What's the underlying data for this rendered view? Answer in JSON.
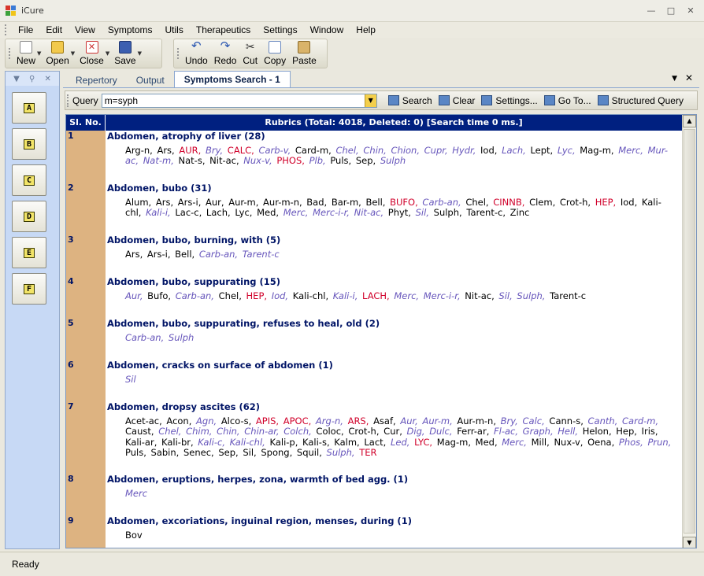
{
  "app": {
    "title": "iCure"
  },
  "menu": [
    "File",
    "Edit",
    "View",
    "Symptoms",
    "Utils",
    "Therapeutics",
    "Settings",
    "Window",
    "Help"
  ],
  "toolbar1": [
    {
      "label": "New",
      "icon": "new-document-icon",
      "dropdown": true
    },
    {
      "label": "Open",
      "icon": "open-folder-icon",
      "dropdown": true
    },
    {
      "label": "Close",
      "icon": "close-document-icon",
      "dropdown": true
    },
    {
      "label": "Save",
      "icon": "save-disk-icon",
      "dropdown": true
    }
  ],
  "toolbar2": [
    {
      "label": "Undo",
      "icon": "undo-icon"
    },
    {
      "label": "Redo",
      "icon": "redo-icon"
    },
    {
      "label": "Cut",
      "icon": "cut-icon"
    },
    {
      "label": "Copy",
      "icon": "copy-icon"
    },
    {
      "label": "Paste",
      "icon": "paste-icon"
    }
  ],
  "left_panel": {
    "buttons": [
      "A",
      "B",
      "C",
      "D",
      "E",
      "F"
    ]
  },
  "tabs": [
    {
      "label": "Repertory",
      "active": false
    },
    {
      "label": "Output",
      "active": false
    },
    {
      "label": "Symptoms Search - 1",
      "active": true
    }
  ],
  "query": {
    "label": "Query",
    "value": "m=syph",
    "buttons": [
      {
        "label": "Search",
        "icon": "search-icon"
      },
      {
        "label": "Clear",
        "icon": "clear-icon"
      },
      {
        "label": "Settings...",
        "icon": "settings-icon"
      },
      {
        "label": "Go To...",
        "icon": "goto-icon"
      },
      {
        "label": "Structured Query",
        "icon": "structured-query-icon"
      }
    ]
  },
  "table": {
    "col_sl": "Sl. No.",
    "col_rubrics": "Rubrics (Total: 4018, Deleted: 0) [Search time 0 ms.]",
    "rows": [
      {
        "num": "1",
        "title": "Abdomen, atrophy of liver (28)",
        "remedies": [
          [
            "Arg-n,",
            1
          ],
          [
            "Ars,",
            1
          ],
          [
            "AUR,",
            3
          ],
          [
            "Bry,",
            2
          ],
          [
            "CALC,",
            3
          ],
          [
            "Carb-v,",
            2
          ],
          [
            "Card-m,",
            1
          ],
          [
            "Chel,",
            2
          ],
          [
            "Chin,",
            2
          ],
          [
            "Chion,",
            2
          ],
          [
            "Cupr,",
            2
          ],
          [
            "Hydr,",
            2
          ],
          [
            "Iod,",
            1
          ],
          [
            "Lach,",
            2
          ],
          [
            "Lept,",
            1
          ],
          [
            "Lyc,",
            2
          ],
          [
            "Mag-m,",
            1
          ],
          [
            "Merc,",
            2
          ],
          [
            "Mur-ac,",
            2
          ],
          [
            "Nat-m,",
            2
          ],
          [
            "Nat-s,",
            1
          ],
          [
            "Nit-ac,",
            1
          ],
          [
            "Nux-v,",
            2
          ],
          [
            "PHOS,",
            3
          ],
          [
            "Plb,",
            2
          ],
          [
            "Puls,",
            1
          ],
          [
            "Sep,",
            1
          ],
          [
            "Sulph",
            2
          ]
        ]
      },
      {
        "num": "2",
        "title": "Abdomen, bubo (31)",
        "remedies": [
          [
            "Alum,",
            1
          ],
          [
            "Ars,",
            1
          ],
          [
            "Ars-i,",
            1
          ],
          [
            "Aur,",
            1
          ],
          [
            "Aur-m,",
            1
          ],
          [
            "Aur-m-n,",
            1
          ],
          [
            "Bad,",
            1
          ],
          [
            "Bar-m,",
            1
          ],
          [
            "Bell,",
            1
          ],
          [
            "BUFO,",
            3
          ],
          [
            "Carb-an,",
            2
          ],
          [
            "Chel,",
            1
          ],
          [
            "CINNB,",
            3
          ],
          [
            "Clem,",
            1
          ],
          [
            "Crot-h,",
            1
          ],
          [
            "HEP,",
            3
          ],
          [
            "Iod,",
            1
          ],
          [
            "Kali-chl,",
            1
          ],
          [
            "Kali-i,",
            2
          ],
          [
            "Lac-c,",
            1
          ],
          [
            "Lach,",
            1
          ],
          [
            "Lyc,",
            1
          ],
          [
            "Med,",
            1
          ],
          [
            "Merc,",
            2
          ],
          [
            "Merc-i-r,",
            2
          ],
          [
            "Nit-ac,",
            2
          ],
          [
            "Phyt,",
            1
          ],
          [
            "Sil,",
            2
          ],
          [
            "Sulph,",
            1
          ],
          [
            "Tarent-c,",
            1
          ],
          [
            "Zinc",
            1
          ]
        ]
      },
      {
        "num": "3",
        "title": "Abdomen, bubo, burning, with (5)",
        "remedies": [
          [
            "Ars,",
            1
          ],
          [
            "Ars-i,",
            1
          ],
          [
            "Bell,",
            1
          ],
          [
            "Carb-an,",
            2
          ],
          [
            "Tarent-c",
            2
          ]
        ]
      },
      {
        "num": "4",
        "title": "Abdomen, bubo, suppurating (15)",
        "remedies": [
          [
            "Aur,",
            2
          ],
          [
            "Bufo,",
            1
          ],
          [
            "Carb-an,",
            2
          ],
          [
            "Chel,",
            1
          ],
          [
            "HEP,",
            3
          ],
          [
            "Iod,",
            2
          ],
          [
            "Kali-chl,",
            1
          ],
          [
            "Kali-i,",
            2
          ],
          [
            "LACH,",
            3
          ],
          [
            "Merc,",
            2
          ],
          [
            "Merc-i-r,",
            2
          ],
          [
            "Nit-ac,",
            1
          ],
          [
            "Sil,",
            2
          ],
          [
            "Sulph,",
            2
          ],
          [
            "Tarent-c",
            1
          ]
        ]
      },
      {
        "num": "5",
        "title": "Abdomen, bubo, suppurating, refuses to heal, old (2)",
        "remedies": [
          [
            "Carb-an,",
            2
          ],
          [
            "Sulph",
            2
          ]
        ]
      },
      {
        "num": "6",
        "title": "Abdomen, cracks on surface of abdomen (1)",
        "remedies": [
          [
            "Sil",
            2
          ]
        ]
      },
      {
        "num": "7",
        "title": "Abdomen, dropsy ascites (62)",
        "remedies": [
          [
            "Acet-ac,",
            1
          ],
          [
            "Acon,",
            1
          ],
          [
            "Agn,",
            2
          ],
          [
            "Alco-s,",
            1
          ],
          [
            "APIS,",
            3
          ],
          [
            "APOC,",
            3
          ],
          [
            "Arg-n,",
            2
          ],
          [
            "ARS,",
            3
          ],
          [
            "Asaf,",
            1
          ],
          [
            "Aur,",
            2
          ],
          [
            "Aur-m,",
            2
          ],
          [
            "Aur-m-n,",
            1
          ],
          [
            "Bry,",
            2
          ],
          [
            "Calc,",
            2
          ],
          [
            "Cann-s,",
            1
          ],
          [
            "Canth,",
            2
          ],
          [
            "Card-m,",
            2
          ],
          [
            "Caust,",
            1
          ],
          [
            "Chel,",
            2
          ],
          [
            "Chim,",
            2
          ],
          [
            "Chin,",
            2
          ],
          [
            "Chin-ar,",
            2
          ],
          [
            "Colch,",
            2
          ],
          [
            "Coloc,",
            1
          ],
          [
            "Crot-h,",
            1
          ],
          [
            "Cur,",
            1
          ],
          [
            "Dig,",
            2
          ],
          [
            "Dulc,",
            2
          ],
          [
            "Ferr-ar,",
            1
          ],
          [
            "Fl-ac,",
            2
          ],
          [
            "Graph,",
            2
          ],
          [
            "Hell,",
            2
          ],
          [
            "Helon,",
            1
          ],
          [
            "Hep,",
            1
          ],
          [
            "Iris,",
            1
          ],
          [
            "Kali-ar,",
            1
          ],
          [
            "Kali-br,",
            1
          ],
          [
            "Kali-c,",
            2
          ],
          [
            "Kali-chl,",
            2
          ],
          [
            "Kali-p,",
            1
          ],
          [
            "Kali-s,",
            1
          ],
          [
            "Kalm,",
            1
          ],
          [
            "Lact,",
            1
          ],
          [
            "Led,",
            2
          ],
          [
            "LYC,",
            3
          ],
          [
            "Mag-m,",
            1
          ],
          [
            "Med,",
            1
          ],
          [
            "Merc,",
            2
          ],
          [
            "Mill,",
            1
          ],
          [
            "Nux-v,",
            1
          ],
          [
            "Oena,",
            1
          ],
          [
            "Phos,",
            2
          ],
          [
            "Prun,",
            2
          ],
          [
            "Puls,",
            1
          ],
          [
            "Sabin,",
            1
          ],
          [
            "Senec,",
            1
          ],
          [
            "Sep,",
            1
          ],
          [
            "Sil,",
            1
          ],
          [
            "Spong,",
            1
          ],
          [
            "Squil,",
            1
          ],
          [
            "Sulph,",
            2
          ],
          [
            "TER",
            3
          ]
        ]
      },
      {
        "num": "8",
        "title": "Abdomen, eruptions, herpes, zona, warmth of bed agg. (1)",
        "remedies": [
          [
            "Merc",
            2
          ]
        ]
      },
      {
        "num": "9",
        "title": "Abdomen, excoriations, inguinal region, menses, during (1)",
        "remedies": [
          [
            "Bov",
            1
          ]
        ]
      }
    ]
  },
  "status": {
    "text": "Ready"
  }
}
